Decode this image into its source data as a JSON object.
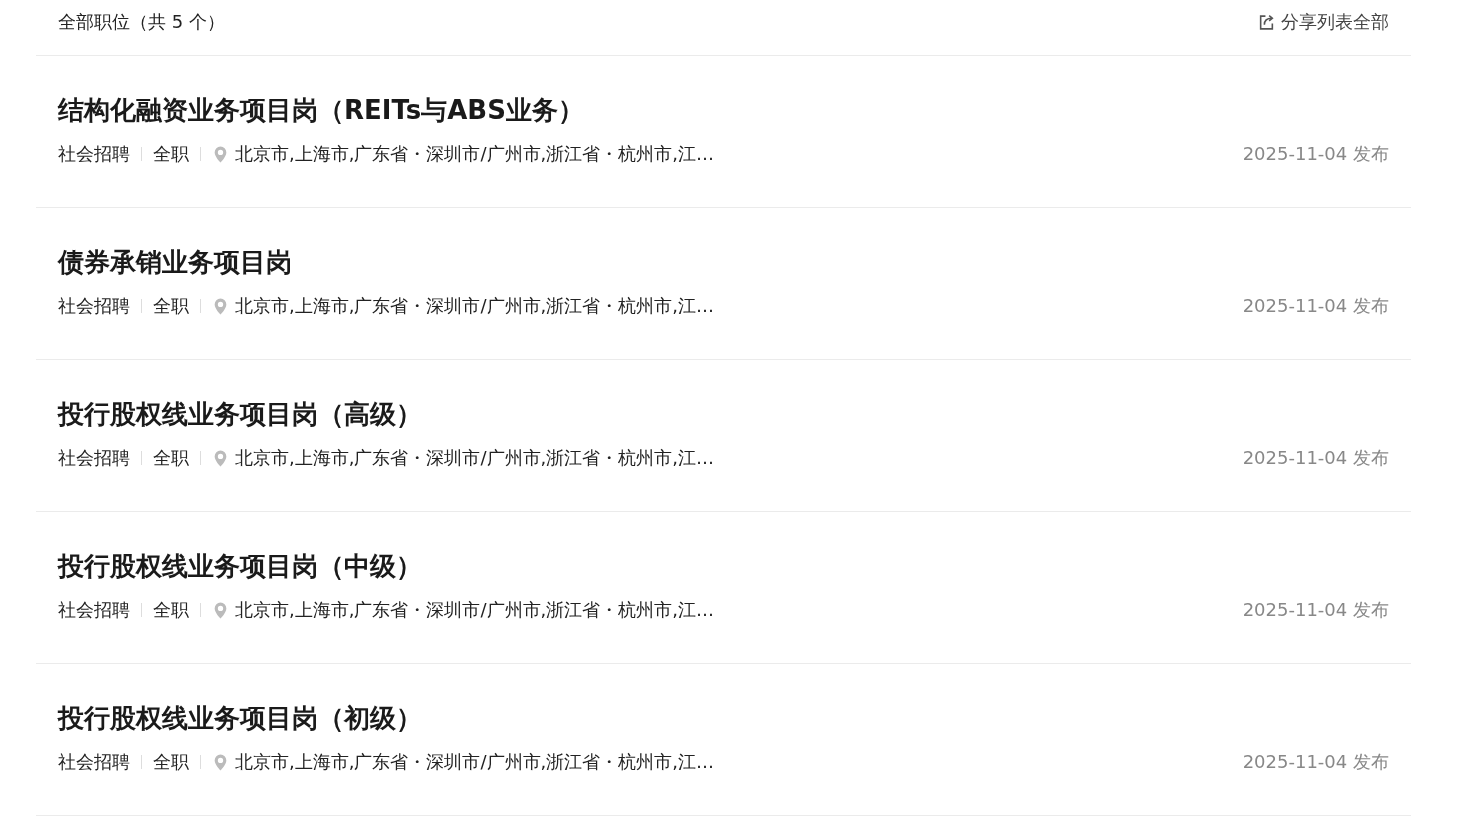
{
  "header": {
    "title": "全部职位（共 5 个）",
    "share": "分享列表全部"
  },
  "jobs": [
    {
      "title": "结构化融资业务项目岗（REITs与ABS业务）",
      "type": "社会招聘",
      "mode": "全职",
      "location": "北京市,上海市,广东省・深圳市/广州市,浙江省・杭州市,江…",
      "date": "2025-11-04 发布"
    },
    {
      "title": "债券承销业务项目岗",
      "type": "社会招聘",
      "mode": "全职",
      "location": "北京市,上海市,广东省・深圳市/广州市,浙江省・杭州市,江…",
      "date": "2025-11-04 发布"
    },
    {
      "title": "投行股权线业务项目岗（高级）",
      "type": "社会招聘",
      "mode": "全职",
      "location": "北京市,上海市,广东省・深圳市/广州市,浙江省・杭州市,江…",
      "date": "2025-11-04 发布"
    },
    {
      "title": "投行股权线业务项目岗（中级）",
      "type": "社会招聘",
      "mode": "全职",
      "location": "北京市,上海市,广东省・深圳市/广州市,浙江省・杭州市,江…",
      "date": "2025-11-04 发布"
    },
    {
      "title": "投行股权线业务项目岗（初级）",
      "type": "社会招聘",
      "mode": "全职",
      "location": "北京市,上海市,广东省・深圳市/广州市,浙江省・杭州市,江…",
      "date": "2025-11-04 发布"
    }
  ]
}
